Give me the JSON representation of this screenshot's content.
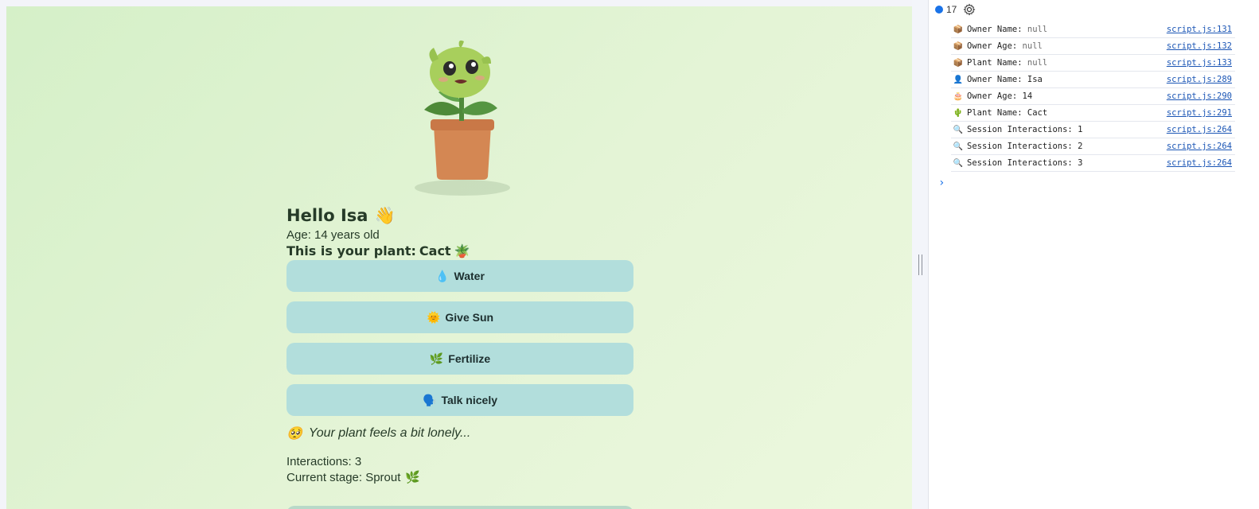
{
  "app": {
    "greeting": "Hello Isa",
    "greeting_emoji": "👋",
    "age_text": "Age: 14 years old",
    "plant_prefix": "This is your plant:",
    "plant_name": "Cact",
    "plant_emoji": "🪴",
    "buttons": [
      {
        "icon": "💧",
        "label": "Water"
      },
      {
        "icon": "🌞",
        "label": "Give Sun"
      },
      {
        "icon": "🌿",
        "label": "Fertilize"
      },
      {
        "icon": "🗣️",
        "label": "Talk nicely"
      }
    ],
    "status_emoji": "🥺",
    "status_text": "Your plant feels a bit lonely...",
    "interactions_text": "Interactions: 3",
    "stage_text": "Current stage: Sprout",
    "stage_emoji": "🌿"
  },
  "devtools": {
    "message_count": "17",
    "logs": [
      {
        "icon": "📦",
        "label": "Owner Name:",
        "value": "null",
        "null": true,
        "source": "script.js:131"
      },
      {
        "icon": "📦",
        "label": "Owner Age:",
        "value": "null",
        "null": true,
        "source": "script.js:132"
      },
      {
        "icon": "📦",
        "label": "Plant Name:",
        "value": "null",
        "null": true,
        "source": "script.js:133"
      },
      {
        "icon": "👤",
        "label": "Owner Name:",
        "value": "Isa",
        "null": false,
        "source": "script.js:289"
      },
      {
        "icon": "🎂",
        "label": "Owner Age:",
        "value": "14",
        "null": false,
        "source": "script.js:290"
      },
      {
        "icon": "🌵",
        "label": "Plant Name:",
        "value": "Cact",
        "null": false,
        "source": "script.js:291"
      },
      {
        "icon": "🔍",
        "label": "Session Interactions:",
        "value": "1",
        "null": false,
        "source": "script.js:264"
      },
      {
        "icon": "🔍",
        "label": "Session Interactions:",
        "value": "2",
        "null": false,
        "source": "script.js:264"
      },
      {
        "icon": "🔍",
        "label": "Session Interactions:",
        "value": "3",
        "null": false,
        "source": "script.js:264"
      }
    ],
    "prompt_symbol": "›"
  }
}
